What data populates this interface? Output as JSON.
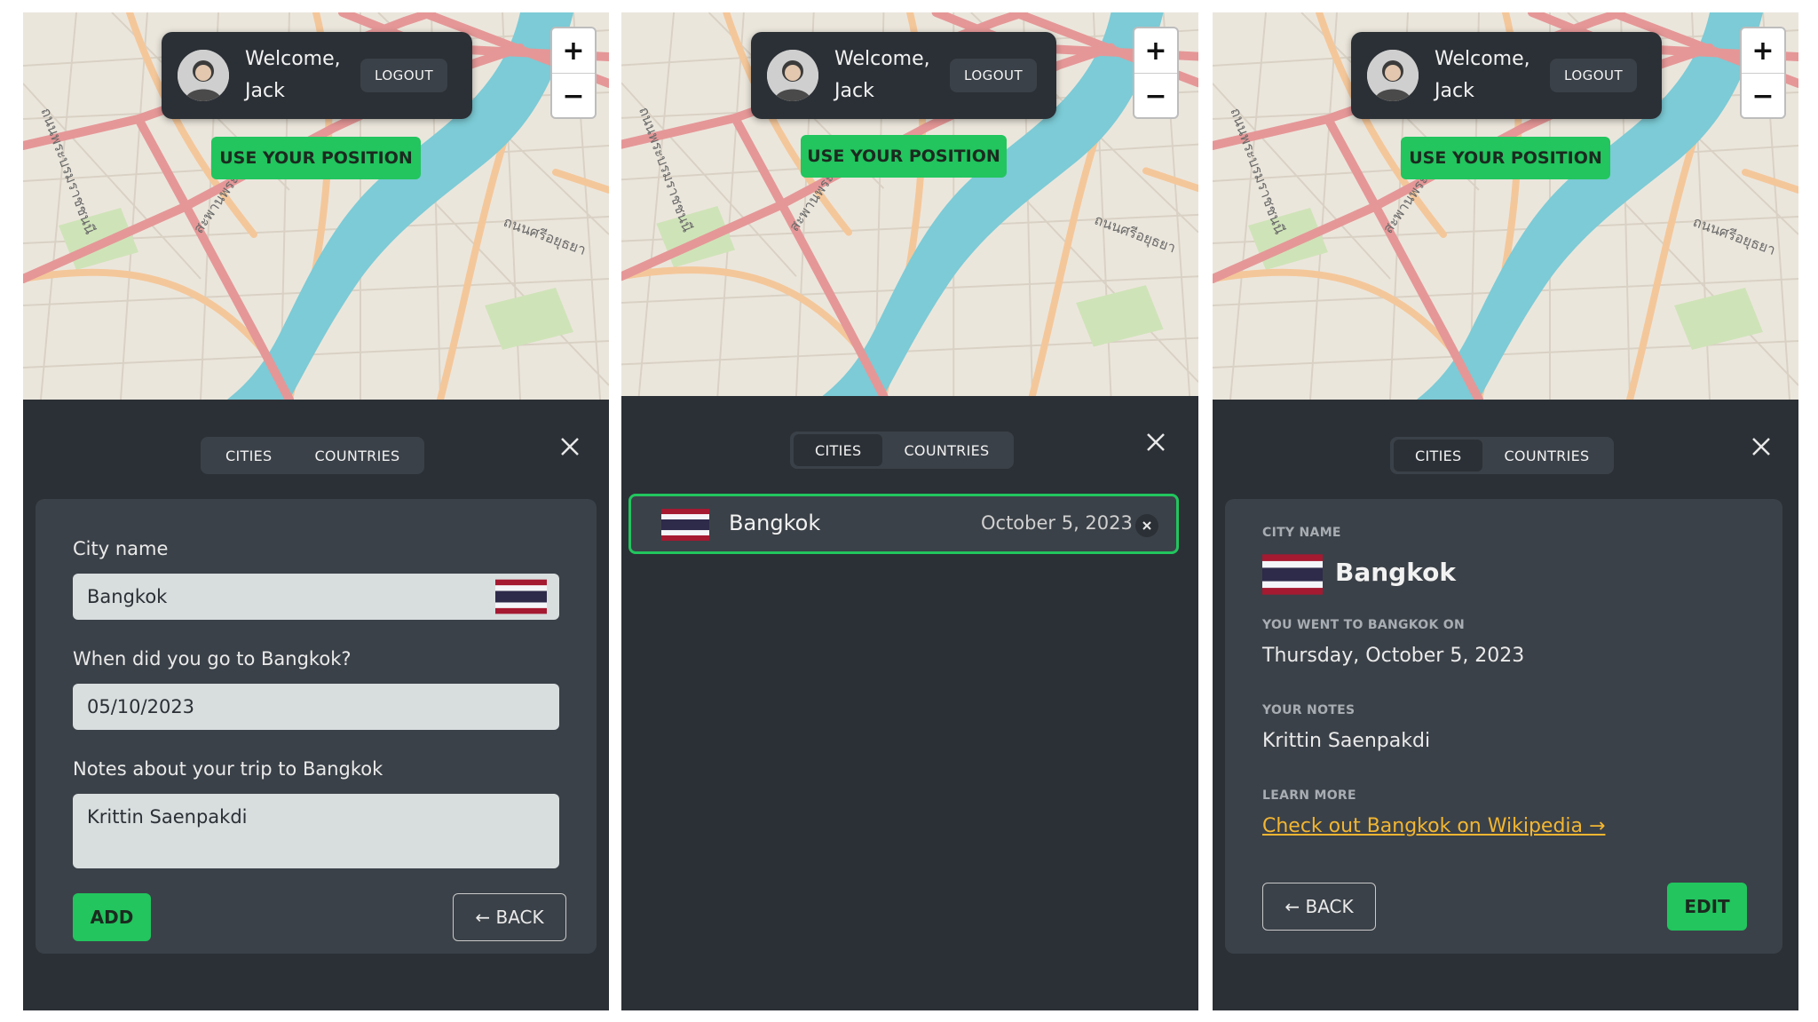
{
  "colors": {
    "panel": "#2b3036",
    "card": "#3b4148",
    "accent": "#22c55e",
    "link": "#f2b632",
    "input": "#d8dede"
  },
  "header": {
    "welcome_line1": "Welcome,",
    "welcome_line2": "Jack",
    "logout_label": "LOGOUT",
    "use_position_label": "USE YOUR POSITION",
    "zoom_in": "+",
    "zoom_out": "−"
  },
  "tabs": {
    "cities": "CITIES",
    "countries": "COUNTRIES"
  },
  "form": {
    "city_label": "City name",
    "city_value": "Bangkok",
    "date_label": "When did you go to Bangkok?",
    "date_value": "05/10/2023",
    "notes_label": "Notes about your trip to Bangkok",
    "notes_value": "Krittin Saenpakdi",
    "add_label": "ADD",
    "back_label": "← BACK"
  },
  "list": {
    "items": [
      {
        "city": "Bangkok",
        "date": "October 5, 2023",
        "flag_icon": "thailand-flag-icon"
      }
    ]
  },
  "detail": {
    "city_name_label": "CITY NAME",
    "city_name": "Bangkok",
    "went_label": "YOU WENT TO BANGKOK ON",
    "went_value": "Thursday, October 5, 2023",
    "notes_label": "YOUR NOTES",
    "notes_value": "Krittin Saenpakdi",
    "learn_label": "LEARN MORE",
    "learn_link": "Check out Bangkok on Wikipedia →",
    "back_label": "← BACK",
    "edit_label": "EDIT"
  },
  "icons": {
    "close": "close-icon",
    "flag": "thailand-flag-icon",
    "avatar": "user-avatar"
  }
}
